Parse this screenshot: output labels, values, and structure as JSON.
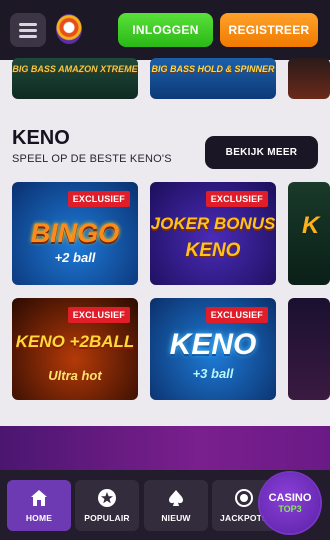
{
  "header": {
    "login_label": "INLOGGEN",
    "register_label": "REGISTREER"
  },
  "top_row": {
    "tiles": [
      {
        "title": "BIG BASS AMAZON XTREME"
      },
      {
        "title": "BIG BASS HOLD & SPINNER"
      },
      {
        "title": ""
      }
    ]
  },
  "keno_section": {
    "title": "KENO",
    "subtitle": "SPEEL OP DE BESTE KENO'S",
    "more_label": "BEKIJK MEER",
    "games": [
      {
        "badge": "EXCLUSIEF",
        "title_line1": "BINGO",
        "title_line2": "+2 ball"
      },
      {
        "badge": "EXCLUSIEF",
        "title_line1": "JOKER BONUS",
        "title_line2": "KENO"
      },
      {
        "badge": "",
        "title_line1": "K",
        "title_line2": ""
      },
      {
        "badge": "EXCLUSIEF",
        "title_line1": "KENO +2BALL",
        "title_line2": "Ultra hot"
      },
      {
        "badge": "EXCLUSIEF",
        "title_line1": "KENO",
        "title_line2": "+3 ball"
      },
      {
        "badge": "",
        "title_line1": "",
        "title_line2": ""
      }
    ]
  },
  "bottom_nav": {
    "items": [
      {
        "label": "HOME",
        "icon": "home-icon"
      },
      {
        "label": "POPULAIR",
        "icon": "star-icon"
      },
      {
        "label": "NIEUW",
        "icon": "spade-icon"
      },
      {
        "label": "JACKPOTS",
        "icon": "coins-icon"
      }
    ]
  },
  "badge_logo": {
    "line1": "CASINO",
    "line2": "TOP3"
  },
  "colors": {
    "login": "#3dcb23",
    "register": "#f98a10",
    "active_nav": "#6d3ab3",
    "badge": "#e01e2a"
  }
}
